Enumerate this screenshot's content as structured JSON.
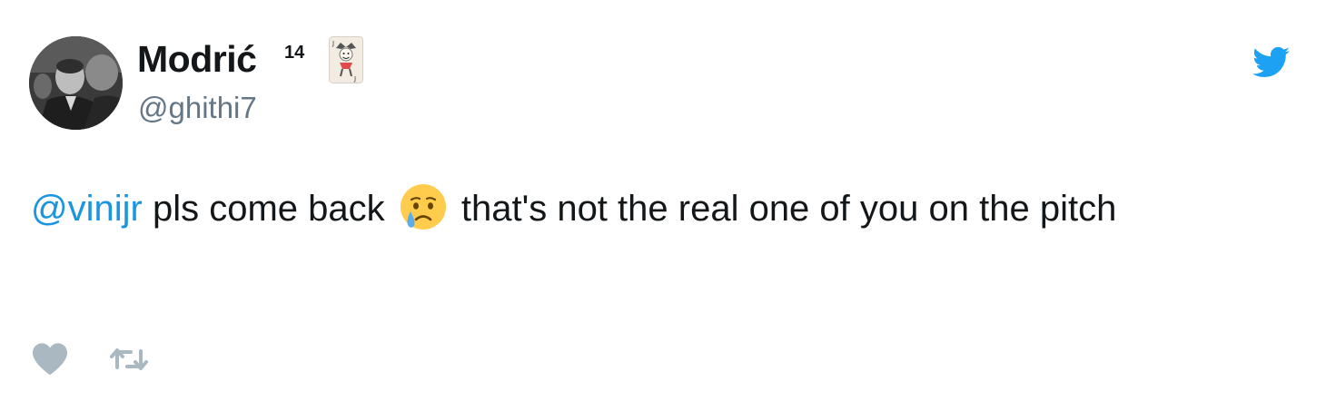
{
  "tweet": {
    "display_name": "Modrić",
    "name_suffix": "14",
    "name_emoji": "joker-playing-card-icon",
    "handle": "@ghithi7",
    "mention": "@vinijr",
    "text_before_emoji": " pls come back ",
    "emoji": "crying-face-icon",
    "text_after_emoji": " that's not the real one of you on the pitch"
  },
  "icons": {
    "brand": "twitter-bird-icon",
    "like": "heart-icon",
    "retweet": "retweet-icon"
  },
  "colors": {
    "twitter_blue": "#1da1f2",
    "mention_blue": "#1b95e0",
    "handle_gray": "#657786",
    "action_gray": "#aab8c2",
    "text_dark": "#14171a"
  }
}
